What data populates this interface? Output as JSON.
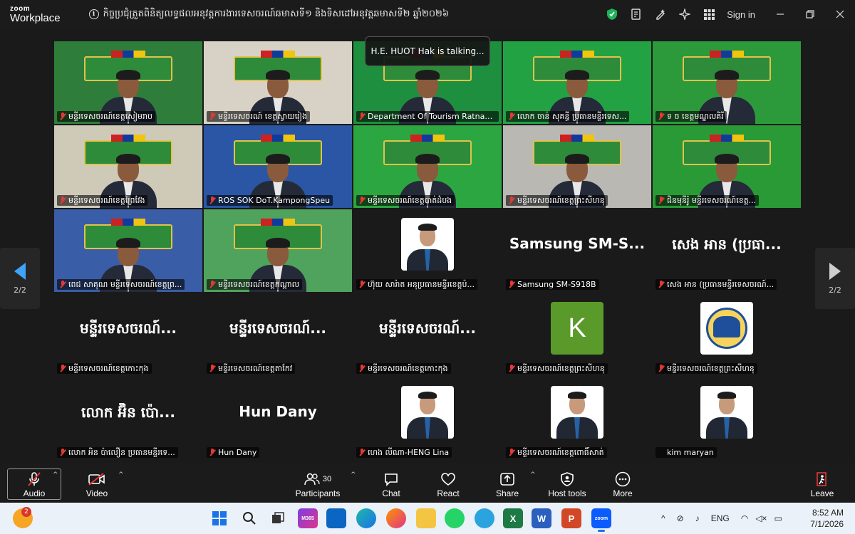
{
  "app": {
    "brand_top": "zoom",
    "brand_bottom": "Workplace",
    "meeting_title": "កិច្ចប្រជុំត្រួតពិនិត្យលទ្ធផលអនុវត្តការងារទេសចរណ៍ឆមាសទី១ និងទិសដៅអនុវត្តឆមាសទី២ ឆ្នាំ២០២៦",
    "signin_label": "Sign in"
  },
  "talking_indicator": "H.E. HUOT Hak is talking...",
  "pager": {
    "left_label": "2/2",
    "right_label": "2/2"
  },
  "tiles": [
    {
      "name": "មន្ទីរទេសចរណ៍ខេត្តសៀមរាប",
      "kind": "video",
      "bg": "#2f7d3b",
      "muted": true
    },
    {
      "name": "មន្ទីរទេសចរណ៍ ខេត្តស្វាយរៀង",
      "kind": "video",
      "bg": "#d8d2c6",
      "muted": true
    },
    {
      "name": "Department Of Tourism Ratnakiri",
      "kind": "video",
      "bg": "#1d8f3f",
      "muted": true
    },
    {
      "name": "លោក ចាន់ សុគន្ធី ប្រធានមន្ទីរទេស...",
      "kind": "video",
      "bg": "#23a244",
      "muted": true
    },
    {
      "name": "ទ ច ខេត្តមណ្ឌលគិរី",
      "kind": "video",
      "bg": "#2c9a3b",
      "muted": true
    },
    {
      "name": "មន្ទីរទេសចរណ៍ខេត្តព្រៃវែង",
      "kind": "video",
      "bg": "#cfcab8",
      "muted": true
    },
    {
      "name": "ROS SOK DoT.KampongSpeu",
      "kind": "video",
      "bg": "#2a56a5",
      "muted": true
    },
    {
      "name": "មន្ទីរទេសចរណ៍ខេត្តបាត់ដំបង",
      "kind": "video",
      "bg": "#2ca640",
      "muted": true
    },
    {
      "name": "មន្ទីរទេសចរណ៍ខេត្តព្រះសីហនុ",
      "kind": "video",
      "bg": "#b9b8b3",
      "muted": true
    },
    {
      "name": "ជិនមុនីរ៉ូ មន្ទីរទេសចរណ៍ខេត្ត...",
      "kind": "video",
      "bg": "#2a9a37",
      "muted": true
    },
    {
      "name": "ពេជ សាគុណ មន្ទីរទេសចរណ៍ខេត្តព្រ...",
      "kind": "video",
      "bg": "#3a5da8",
      "muted": true
    },
    {
      "name": "មន្ទីរទេសចរណ៍ខេត្តកណ្តាល",
      "kind": "video",
      "bg": "#4fa35c",
      "muted": true
    },
    {
      "name": "ហ៊ុយ សារ៉ាត អនុប្រធានមន្ទីរខេត្តប៉...",
      "kind": "photo",
      "muted": true
    },
    {
      "name": "Samsung SM-S918B",
      "kind": "text",
      "big": "Samsung  SM-S...",
      "muted": true
    },
    {
      "name": "សេង អាន (ប្រធានមន្ទីរទេសចរណ៍...",
      "kind": "text",
      "big": "សេង អាន (ប្រធា...",
      "muted": true
    },
    {
      "name": "មន្ទីរទេសចរណ៍ខេត្តកោះកុង",
      "kind": "text",
      "big": "មន្ទីរទេសចរណ៍...",
      "muted": true
    },
    {
      "name": "មន្ទីរទេសចរណ៍ខេត្តតាកែវ",
      "kind": "text",
      "big": "មន្ទីរទេសចរណ៍...",
      "muted": true
    },
    {
      "name": "មន្ទីរទេសចរណ៍ខេត្តកោះកុង",
      "kind": "text",
      "big": "មន្ទីរទេសចរណ៍...",
      "muted": true
    },
    {
      "name": "មន្ទីរទេសចរណ៍ខេត្តព្រះសីហនុ",
      "kind": "letter",
      "letter": "K",
      "muted": true
    },
    {
      "name": "មន្ទីរទេសចរណ៍ខេត្តព្រះសីហនុ",
      "kind": "logo",
      "muted": true
    },
    {
      "name": "លោក អិន ប៉ាលឿន ប្រធានមន្ទីរទេ...",
      "kind": "text",
      "big": "លោក អ៊ិន ប៉ោ...",
      "muted": true
    },
    {
      "name": "Hun Dany",
      "kind": "text",
      "big": "Hun Dany",
      "muted": true
    },
    {
      "name": "ហេង លីណា-HENG Lina",
      "kind": "photo",
      "muted": true
    },
    {
      "name": "មន្ទីរទេសចរណ៍ខេត្តពោធិ៍សាត់",
      "kind": "photo",
      "muted": true
    },
    {
      "name": "kim maryan",
      "kind": "photo",
      "muted": false
    }
  ],
  "toolbar": {
    "audio": "Audio",
    "video": "Video",
    "participants": "Participants",
    "participant_count": "30",
    "chat": "Chat",
    "react": "React",
    "share": "Share",
    "host_tools": "Host tools",
    "more": "More",
    "leave": "Leave"
  },
  "taskbar": {
    "notification_count": "2",
    "language": "ENG",
    "time": "8:52 AM",
    "date": "7/1/2026",
    "m365_label": "M365"
  },
  "colors": {
    "accent_blue": "#3fa3f7",
    "mute_red": "#e53935",
    "zoom_blue": "#0b5cff",
    "shield_green": "#1fb45a"
  }
}
